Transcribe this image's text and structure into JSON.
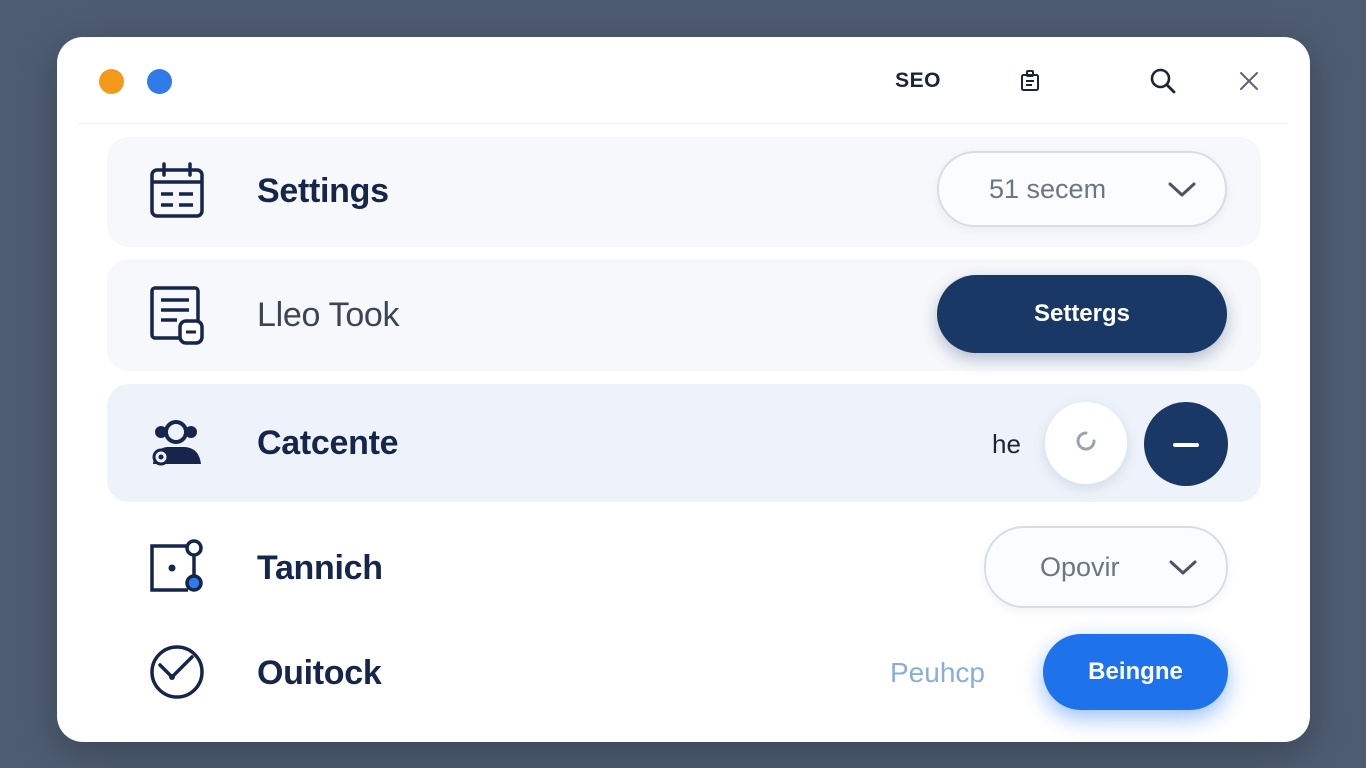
{
  "titlebar": {
    "traffic_lights": [
      {
        "name": "orange",
        "color": "#f39a1a"
      },
      {
        "name": "blue",
        "color": "#2f7bea"
      }
    ],
    "label": "SEO",
    "icons": [
      "clipboard-icon",
      "search-icon",
      "close-icon"
    ]
  },
  "rows": [
    {
      "icon": "calendar-icon",
      "label": "Settings",
      "control": {
        "type": "select",
        "value": "51 secem"
      }
    },
    {
      "icon": "document-lock-icon",
      "label": "Lleo Took",
      "control": {
        "type": "button",
        "label": "Settergs"
      }
    },
    {
      "icon": "users-icon",
      "label": "Catcente",
      "control": {
        "type": "stepper",
        "text": "he",
        "minus_icon": "minus-icon",
        "spinner_icon": "loading-icon"
      }
    },
    {
      "icon": "node-box-icon",
      "label": "Tannich",
      "control": {
        "type": "select",
        "value": "Opovir"
      }
    },
    {
      "icon": "gauge-icon",
      "label": "Ouitock",
      "control": {
        "type": "button",
        "text": "Peuhcp",
        "label": "Beingne"
      }
    }
  ],
  "colors": {
    "background": "#4e5c72",
    "navy": "#193866",
    "primary_blue": "#1e73ec",
    "heading": "#15264a"
  }
}
